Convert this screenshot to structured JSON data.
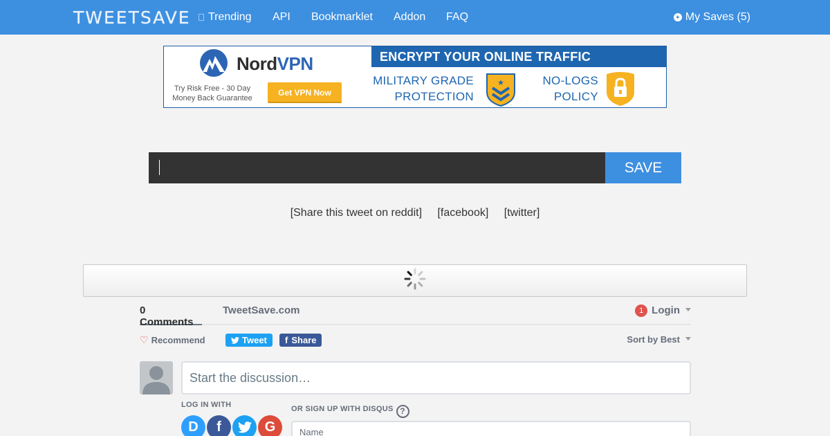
{
  "navbar": {
    "brand": "TWEETSAVE",
    "links": [
      "Trending",
      "API",
      "Bookmarklet",
      "Addon",
      "FAQ"
    ],
    "my_saves": "My Saves (5)"
  },
  "ad": {
    "brand_part1": "Nord",
    "brand_part2": "VPN",
    "guarantee": "Try Risk Free - 30 Day Money Back Guarantee",
    "cta": "Get VPN Now",
    "headline": "ENCRYPT YOUR ONLINE TRAFFIC",
    "feature1": "MILITARY GRADE PROTECTION",
    "feature2": "NO-LOGS POLICY"
  },
  "save_form": {
    "input_value": "",
    "button": "SAVE"
  },
  "share": {
    "reddit": "[Share this tweet on reddit]",
    "facebook": "[facebook]",
    "twitter": "[twitter]"
  },
  "disqus": {
    "comments_tab": "0 Comments",
    "site_tab": "TweetSave.com",
    "badge_count": "1",
    "login": "Login",
    "recommend": "Recommend",
    "tweet": "Tweet",
    "share": "Share",
    "sort": "Sort by Best",
    "compose_placeholder": "Start the discussion…",
    "log_in_with": "LOG IN WITH",
    "sign_up_with": "OR SIGN UP WITH DISQUS",
    "name_placeholder": "Name",
    "social": [
      "D",
      "f",
      "",
      "G"
    ]
  },
  "colors": {
    "navbar": "#3d8fe0",
    "input_bg": "#333333",
    "save_button": "#3d8fe0",
    "disqus_badge": "#e0524d"
  }
}
